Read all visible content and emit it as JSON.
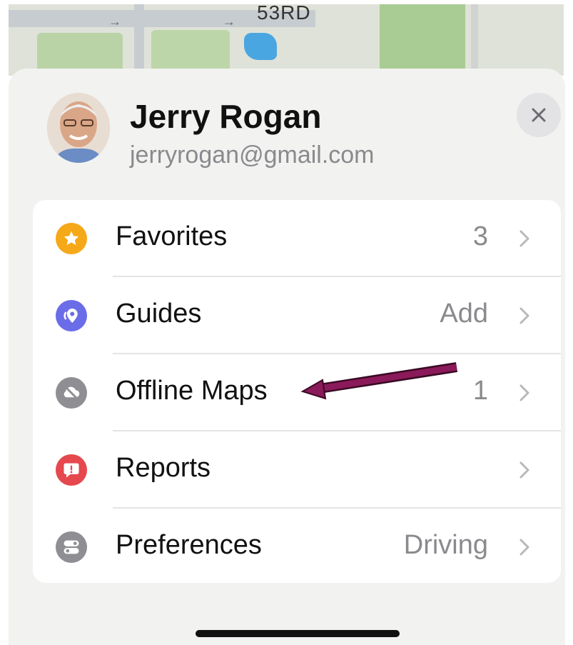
{
  "map": {
    "street_label": "53RD"
  },
  "profile": {
    "name": "Jerry Rogan",
    "email": "jerryrogan@gmail.com"
  },
  "menu": {
    "items": [
      {
        "label": "Favorites",
        "value": "3",
        "icon": "star-icon",
        "color": "#f5a818"
      },
      {
        "label": "Guides",
        "value": "Add",
        "icon": "guides-icon",
        "color": "#6b6ce8"
      },
      {
        "label": "Offline Maps",
        "value": "1",
        "icon": "cloud-offline-icon",
        "color": "#8e8e93"
      },
      {
        "label": "Reports",
        "value": "",
        "icon": "report-bubble-icon",
        "color": "#e5484d"
      },
      {
        "label": "Preferences",
        "value": "Driving",
        "icon": "toggles-icon",
        "color": "#8e8e93"
      }
    ]
  },
  "annotation": {
    "color": "#8b1a5a",
    "target": "Offline Maps"
  }
}
